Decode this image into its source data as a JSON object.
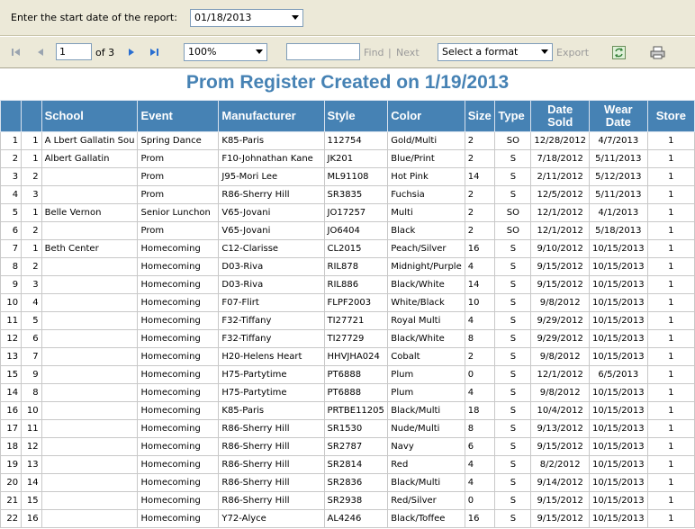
{
  "parameters": {
    "start_date_label": "Enter the start date of the report:",
    "start_date_value": "01/18/2013"
  },
  "toolbar": {
    "page_current": "1",
    "page_of": "of 3",
    "zoom": "100%",
    "find_label": "Find",
    "separator": "|",
    "next_label": "Next",
    "format_placeholder": "Select a format",
    "export_label": "Export",
    "icons": [
      "first-page-icon",
      "previous-page-icon",
      "next-page-icon",
      "last-page-icon",
      "refresh-icon",
      "print-icon"
    ]
  },
  "report": {
    "title": "Prom Register Created on 1/19/2013",
    "columns": [
      "",
      "",
      "School",
      "Event",
      "Manufacturer",
      "Style",
      "Color",
      "Size",
      "Type",
      "Date Sold",
      "Wear Date",
      "Store"
    ],
    "rows": [
      [
        "1",
        "1",
        "A Lbert Gallatin Sou",
        "Spring Dance",
        "K85-Paris",
        "112754",
        "Gold/Multi",
        "2",
        "SO",
        "12/28/2012",
        "4/7/2013",
        "1"
      ],
      [
        "2",
        "1",
        "Albert Gallatin",
        "Prom",
        "F10-Johnathan Kane",
        "JK201",
        "Blue/Print",
        "2",
        "S",
        "7/18/2012",
        "5/11/2013",
        "1"
      ],
      [
        "3",
        "2",
        "",
        "Prom",
        "J95-Mori Lee",
        "ML91108",
        "Hot Pink",
        "14",
        "S",
        "2/11/2012",
        "5/12/2013",
        "1"
      ],
      [
        "4",
        "3",
        "",
        "Prom",
        "R86-Sherry Hill",
        "SR3835",
        "Fuchsia",
        "2",
        "S",
        "12/5/2012",
        "5/11/2013",
        "1"
      ],
      [
        "5",
        "1",
        "Belle Vernon",
        "Senior Lunchon",
        "V65-Jovani",
        "JO17257",
        "Multi",
        "2",
        "SO",
        "12/1/2012",
        "4/1/2013",
        "1"
      ],
      [
        "6",
        "2",
        "",
        "Prom",
        "V65-Jovani",
        "JO6404",
        "Black",
        "2",
        "SO",
        "12/1/2012",
        "5/18/2013",
        "1"
      ],
      [
        "7",
        "1",
        "Beth Center",
        "Homecoming",
        "C12-Clarisse",
        "CL2015",
        "Peach/Silver",
        "16",
        "S",
        "9/10/2012",
        "10/15/2013",
        "1"
      ],
      [
        "8",
        "2",
        "",
        "Homecoming",
        "D03-Riva",
        "RIL878",
        "Midnight/Purple",
        "4",
        "S",
        "9/15/2012",
        "10/15/2013",
        "1"
      ],
      [
        "9",
        "3",
        "",
        "Homecoming",
        "D03-Riva",
        "RIL886",
        "Black/White",
        "14",
        "S",
        "9/15/2012",
        "10/15/2013",
        "1"
      ],
      [
        "10",
        "4",
        "",
        "Homecoming",
        "F07-Flirt",
        "FLPF2003",
        "White/Black",
        "10",
        "S",
        "9/8/2012",
        "10/15/2013",
        "1"
      ],
      [
        "11",
        "5",
        "",
        "Homecoming",
        "F32-Tiffany",
        "TI27721",
        "Royal Multi",
        "4",
        "S",
        "9/29/2012",
        "10/15/2013",
        "1"
      ],
      [
        "12",
        "6",
        "",
        "Homecoming",
        "F32-Tiffany",
        "TI27729",
        "Black/White",
        "8",
        "S",
        "9/29/2012",
        "10/15/2013",
        "1"
      ],
      [
        "13",
        "7",
        "",
        "Homecoming",
        "H20-Helens Heart",
        "HHVJHA024",
        "Cobalt",
        "2",
        "S",
        "9/8/2012",
        "10/15/2013",
        "1"
      ],
      [
        "15",
        "9",
        "",
        "Homecoming",
        "H75-Partytime",
        "PT6888",
        "Plum",
        "0",
        "S",
        "12/1/2012",
        "6/5/2013",
        "1"
      ],
      [
        "14",
        "8",
        "",
        "Homecoming",
        "H75-Partytime",
        "PT6888",
        "Plum",
        "4",
        "S",
        "9/8/2012",
        "10/15/2013",
        "1"
      ],
      [
        "16",
        "10",
        "",
        "Homecoming",
        "K85-Paris",
        "PRTBE11205",
        "Black/Multi",
        "18",
        "S",
        "10/4/2012",
        "10/15/2013",
        "1"
      ],
      [
        "17",
        "11",
        "",
        "Homecoming",
        "R86-Sherry Hill",
        "SR1530",
        "Nude/Multi",
        "8",
        "S",
        "9/13/2012",
        "10/15/2013",
        "1"
      ],
      [
        "18",
        "12",
        "",
        "Homecoming",
        "R86-Sherry Hill",
        "SR2787",
        "Navy",
        "6",
        "S",
        "9/15/2012",
        "10/15/2013",
        "1"
      ],
      [
        "19",
        "13",
        "",
        "Homecoming",
        "R86-Sherry Hill",
        "SR2814",
        "Red",
        "4",
        "S",
        "8/2/2012",
        "10/15/2013",
        "1"
      ],
      [
        "20",
        "14",
        "",
        "Homecoming",
        "R86-Sherry Hill",
        "SR2836",
        "Black/Multi",
        "4",
        "S",
        "9/14/2012",
        "10/15/2013",
        "1"
      ],
      [
        "21",
        "15",
        "",
        "Homecoming",
        "R86-Sherry Hill",
        "SR2938",
        "Red/Silver",
        "0",
        "S",
        "9/15/2012",
        "10/15/2013",
        "1"
      ],
      [
        "22",
        "16",
        "",
        "Homecoming",
        "Y72-Alyce",
        "AL4246",
        "Black/Toffee",
        "16",
        "S",
        "9/15/2012",
        "10/15/2013",
        "1"
      ]
    ]
  },
  "colors": {
    "header_bg": "#4682b4",
    "title": "#4682b4",
    "toolbar_bg": "#ece9d8"
  }
}
